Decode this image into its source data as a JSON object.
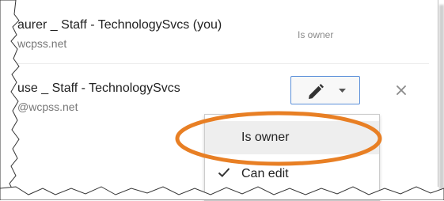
{
  "collaborators": [
    {
      "name": "aurer _ Staff - TechnologySvcs (you)",
      "email": "wcpss.net",
      "role": "Is owner"
    },
    {
      "name": "use _ Staff - TechnologySvcs",
      "email": "@wcpss.net",
      "permission_icon": "pencil-icon",
      "remove_icon": "close-icon"
    }
  ],
  "permission_menu": {
    "items": [
      {
        "label": "Is owner",
        "hovered": true,
        "highlighted_annotation": true
      },
      {
        "label": "Can edit",
        "checked": true
      }
    ]
  },
  "colors": {
    "button_border": "#5b8fd9",
    "annotation_ellipse": "#e87f24",
    "menu_hover": "#eeeeee"
  }
}
